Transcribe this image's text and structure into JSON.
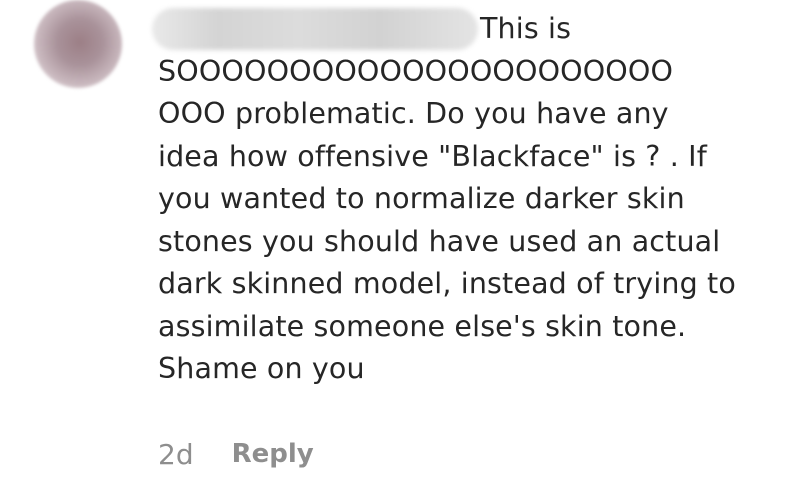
{
  "comment": {
    "text": "This is\nSOOOOOOOOOOOOOOOOOOOOOO\nOOO problematic. Do you have any\nidea how offensive \"Blackface\" is ? . If\nyou wanted to normalize darker skin\nstones you should have used an actual\ndark skinned model, instead of trying to\nassimilate someone else's skin tone.\nShame on you",
    "timestamp": "2d",
    "reply_label": "Reply"
  }
}
